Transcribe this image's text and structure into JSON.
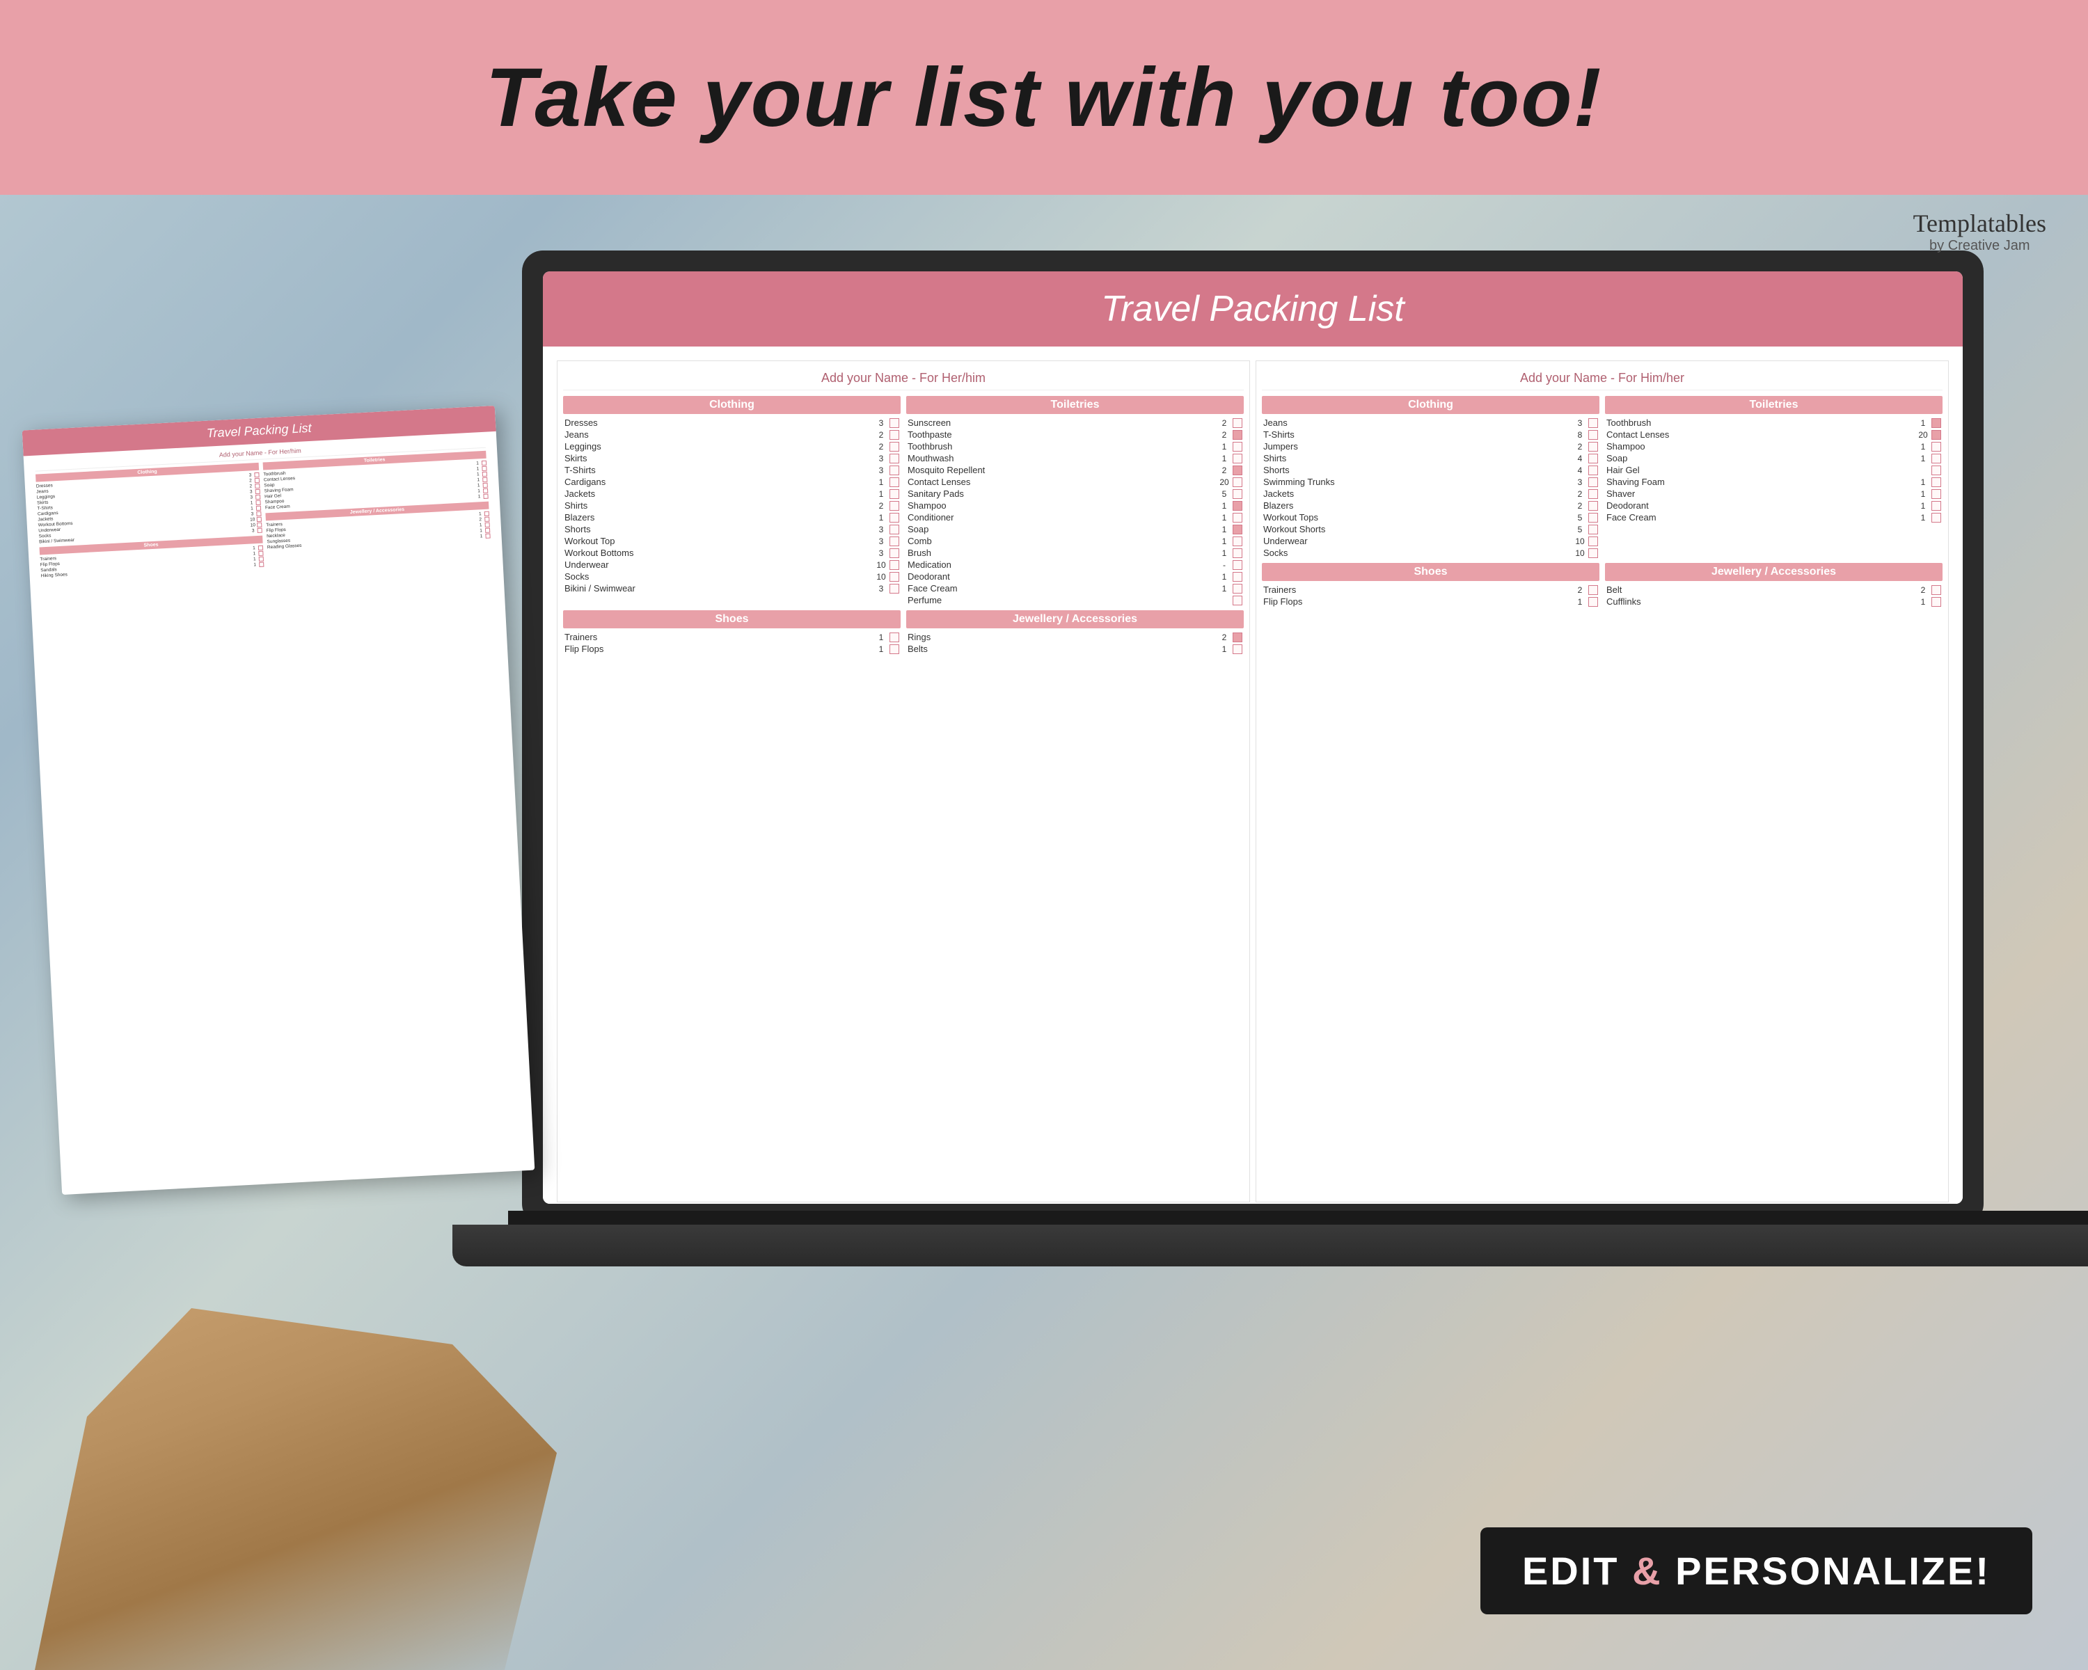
{
  "banner": {
    "title": "Take your list with you too!"
  },
  "logo": {
    "brand": "Templatables",
    "sub": "by Creative Jam"
  },
  "screen": {
    "title_italic": "Travel",
    "title_regular": " Packing List",
    "her_name": "Add your Name - For Her/him",
    "his_name": "Add your Name - For Him/her",
    "sections": {
      "clothing": "Clothing",
      "toiletries": "Toiletries",
      "shoes": "Shoes",
      "jewellery": "Jewellery / Accessories"
    }
  },
  "her_clothing": [
    {
      "name": "Dresses",
      "qty": "3",
      "checked": false
    },
    {
      "name": "Jeans",
      "qty": "2",
      "checked": false
    },
    {
      "name": "Leggings",
      "qty": "2",
      "checked": false
    },
    {
      "name": "Skirts",
      "qty": "3",
      "checked": false
    },
    {
      "name": "T-Shirts",
      "qty": "3",
      "checked": false
    },
    {
      "name": "Cardigans",
      "qty": "1",
      "checked": false
    },
    {
      "name": "Jackets",
      "qty": "1",
      "checked": false
    },
    {
      "name": "Shirts",
      "qty": "2",
      "checked": false
    },
    {
      "name": "Blazers",
      "qty": "1",
      "checked": false
    },
    {
      "name": "Shorts",
      "qty": "3",
      "checked": false
    },
    {
      "name": "Workout Top",
      "qty": "3",
      "checked": false
    },
    {
      "name": "Workout Bottoms",
      "qty": "3",
      "checked": false
    },
    {
      "name": "Underwear",
      "qty": "10",
      "checked": false
    },
    {
      "name": "Socks",
      "qty": "10",
      "checked": false
    },
    {
      "name": "Bikini / Swimwear",
      "qty": "3",
      "checked": false
    }
  ],
  "her_toiletries": [
    {
      "name": "Sunscreen",
      "qty": "2",
      "checked": false
    },
    {
      "name": "Toothpaste",
      "qty": "2",
      "checked": true
    },
    {
      "name": "Toothbrush",
      "qty": "1",
      "checked": false
    },
    {
      "name": "Mouthwash",
      "qty": "1",
      "checked": false
    },
    {
      "name": "Mosquito Repellent",
      "qty": "2",
      "checked": true
    },
    {
      "name": "Contact Lenses",
      "qty": "20",
      "checked": false
    },
    {
      "name": "Sanitary Pads",
      "qty": "5",
      "checked": false
    },
    {
      "name": "Shampoo",
      "qty": "1",
      "checked": true
    },
    {
      "name": "Conditioner",
      "qty": "1",
      "checked": false
    },
    {
      "name": "Soap",
      "qty": "1",
      "checked": true
    },
    {
      "name": "Comb",
      "qty": "1",
      "checked": false
    },
    {
      "name": "Brush",
      "qty": "1",
      "checked": false
    },
    {
      "name": "Medication",
      "qty": "-",
      "checked": false
    },
    {
      "name": "Deodorant",
      "qty": "1",
      "checked": false
    },
    {
      "name": "Face Cream",
      "qty": "1",
      "checked": false
    },
    {
      "name": "Perfume",
      "qty": "",
      "checked": false
    }
  ],
  "her_shoes": [
    {
      "name": "Trainers",
      "qty": "1",
      "checked": false
    },
    {
      "name": "Flip Flops",
      "qty": "1",
      "checked": false
    }
  ],
  "her_jewellery": [
    {
      "name": "Rings",
      "qty": "2",
      "checked": true
    },
    {
      "name": "Belts",
      "qty": "1",
      "checked": false
    }
  ],
  "his_clothing": [
    {
      "name": "Jeans",
      "qty": "3",
      "checked": false
    },
    {
      "name": "T-Shirts",
      "qty": "8",
      "checked": false
    },
    {
      "name": "Jumpers",
      "qty": "2",
      "checked": false
    },
    {
      "name": "Shirts",
      "qty": "4",
      "checked": false
    },
    {
      "name": "Shorts",
      "qty": "4",
      "checked": false
    },
    {
      "name": "Swimming Trunks",
      "qty": "3",
      "checked": false
    },
    {
      "name": "Jackets",
      "qty": "2",
      "checked": false
    },
    {
      "name": "Blazers",
      "qty": "2",
      "checked": false
    },
    {
      "name": "Workout Tops",
      "qty": "5",
      "checked": false
    },
    {
      "name": "Workout Shorts",
      "qty": "5",
      "checked": false
    },
    {
      "name": "Underwear",
      "qty": "10",
      "checked": false
    },
    {
      "name": "Socks",
      "qty": "10",
      "checked": false
    }
  ],
  "his_toiletries": [
    {
      "name": "Toothbrush",
      "qty": "1",
      "checked": true
    },
    {
      "name": "Contact Lenses",
      "qty": "20",
      "checked": true
    },
    {
      "name": "Shampoo",
      "qty": "1",
      "checked": false
    },
    {
      "name": "Soap",
      "qty": "1",
      "checked": false
    },
    {
      "name": "Hair Gel",
      "qty": "",
      "checked": false
    },
    {
      "name": "Shaving Foam",
      "qty": "1",
      "checked": false
    },
    {
      "name": "Shaver",
      "qty": "1",
      "checked": false
    },
    {
      "name": "Deodorant",
      "qty": "1",
      "checked": false
    },
    {
      "name": "Face Cream",
      "qty": "1",
      "checked": false
    }
  ],
  "his_shoes": [
    {
      "name": "Trainers",
      "qty": "2",
      "checked": false
    },
    {
      "name": "Flip Flops",
      "qty": "1",
      "checked": false
    }
  ],
  "his_jewellery": [
    {
      "name": "Belt",
      "qty": "2",
      "checked": false
    },
    {
      "name": "Cufflinks",
      "qty": "1",
      "checked": false
    }
  ],
  "edit_button": {
    "label": "EDIT & PERSONALIZE!"
  },
  "paper": {
    "title_italic": "Travel",
    "title_regular": " Packing List",
    "name_her": "Add your Name - For Her/him",
    "name_him": "Add your Name - For Him/her"
  }
}
